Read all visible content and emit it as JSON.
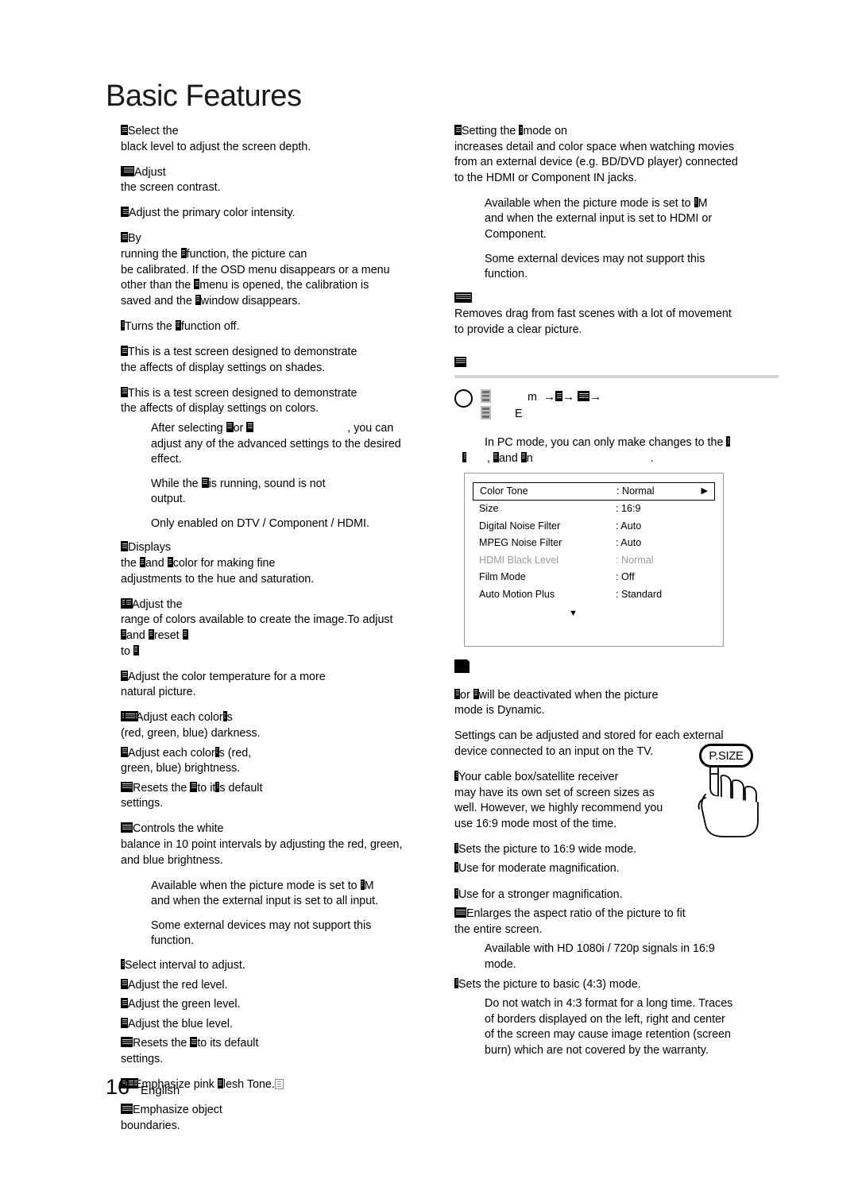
{
  "page": {
    "title": "Basic Features",
    "footer_number": "16",
    "footer_language": "English"
  },
  "left_column": {
    "blocks": [
      {
        "id": "black-tone",
        "lines": [
          "Select the",
          "black level to adjust the screen depth."
        ]
      },
      {
        "id": "contrast",
        "lines": [
          "Adjust",
          "the screen contrast."
        ]
      },
      {
        "id": "color",
        "lines": [
          "Adjust the primary color intensity."
        ]
      },
      {
        "id": "calibration",
        "lines": [
          "By",
          "running the function, the picture can",
          "be calibrated. If the OSD menu disappears or a menu",
          "other than the menu is opened, the calibration is",
          "saved and the window disappears."
        ]
      },
      {
        "id": "off",
        "lines": [
          "Turns the function off."
        ]
      },
      {
        "id": "test-shades",
        "lines": [
          "This is a test screen designed to demonstrate",
          "the affects of display settings on shades."
        ]
      },
      {
        "id": "test-colors",
        "lines": [
          "This is a test screen designed to demonstrate",
          "the affects of display settings on colors."
        ]
      },
      {
        "id": "note-after-selecting",
        "indent": true,
        "lines": [
          "After selecting or , you can",
          "adjust any of the advanced settings to the desired",
          "effect."
        ]
      },
      {
        "id": "note-sound",
        "indent": true,
        "lines": [
          "While the is running, sound is not",
          "output."
        ]
      },
      {
        "id": "note-dtv",
        "indent": true,
        "lines": [
          "Only enabled on DTV / Component / HDMI."
        ]
      },
      {
        "id": "displays-color",
        "lines": [
          "Displays",
          "the and color for making fine",
          "adjustments to the hue and saturation."
        ]
      },
      {
        "id": "color-space",
        "lines": [
          "Adjust the",
          "range of colors available to create the image.To adjust",
          "and reset",
          "to"
        ]
      },
      {
        "id": "white-balance",
        "lines": [
          "Adjust the color temperature for a more",
          "natural picture."
        ]
      },
      {
        "id": "rgb-offset",
        "lines": [
          "Adjust each color's",
          "(red, green, blue) darkness."
        ]
      },
      {
        "id": "rgb-gain",
        "lines": [
          "Adjust each color's (red,",
          "green, blue) brightness."
        ]
      },
      {
        "id": "reset-default-1",
        "lines": [
          "Resets the to its default",
          "settings."
        ]
      },
      {
        "id": "ten-point-white-balance",
        "lines": [
          "Controls the white",
          "balance in 10 point intervals by adjusting the red, green,",
          "and blue brightness."
        ]
      },
      {
        "id": "note-picture-mode",
        "indent": true,
        "lines": [
          "Available when the picture mode is set to",
          "and when the external input is set to all input."
        ]
      },
      {
        "id": "note-external-devices-1",
        "indent": true,
        "lines": [
          "Some external devices may not support this",
          "function."
        ]
      },
      {
        "id": "interval",
        "lines": [
          "Select interval to adjust."
        ]
      },
      {
        "id": "red-level",
        "lines": [
          "Adjust the red level."
        ]
      },
      {
        "id": "green-level",
        "lines": [
          "Adjust the green level."
        ]
      },
      {
        "id": "blue-level",
        "lines": [
          "Adjust the blue level."
        ]
      },
      {
        "id": "reset-default-2",
        "lines": [
          "Resets the to its default",
          "settings."
        ]
      },
      {
        "id": "flesh-tone",
        "lines": [
          "Emphasize pink Flesh Tone."
        ]
      },
      {
        "id": "edge-enhancement",
        "lines": [
          "Emphasize object",
          "boundaries."
        ]
      }
    ]
  },
  "right_column": {
    "blocks": [
      {
        "id": "cinema-mode",
        "lines": [
          "Setting the mode on",
          "increases detail and color space when watching movies",
          "from an external device (e.g. BD/DVD player) connected",
          "to the HDMI or Component IN jacks."
        ]
      },
      {
        "id": "note-cinema-available",
        "indent": true,
        "lines": [
          "Available when the picture mode is set to",
          "and when the external input is set to HDMI or",
          "Component."
        ]
      },
      {
        "id": "note-external-devices-2",
        "indent": true,
        "lines": [
          "Some external devices may not support this",
          "function."
        ]
      },
      {
        "id": "motion-judder",
        "lines": [
          "Removes drag from fast scenes with a lot of movement",
          "to provide a clear picture."
        ]
      }
    ],
    "section_header": {
      "id": "screen-adjustment",
      "label": ""
    },
    "nav_path": {
      "line1_prefix": "m",
      "line2_prefix": "E",
      "arrow": "→"
    },
    "pc_mode_note": [
      "In PC mode, you can only make changes to the",
      ", and"
    ],
    "note_section": {
      "blocks": [
        {
          "id": "deactivated-dynamic",
          "lines": [
            "or will be deactivated when the picture",
            "mode is Dynamic."
          ]
        },
        {
          "id": "stored-per-device",
          "lines": [
            "Settings can be adjusted and stored for each external",
            "device connected to an input on the TV."
          ]
        },
        {
          "id": "cable-box",
          "lines": [
            "Your cable box/satellite receiver",
            "may have its own set of screen sizes as",
            "well. However, we highly recommend you",
            "use 16:9 mode most of the time."
          ]
        },
        {
          "id": "wide-16-9",
          "lines": [
            "Sets the picture to 16:9 wide mode."
          ]
        },
        {
          "id": "zoom-1",
          "lines": [
            "Use for moderate magnification."
          ]
        },
        {
          "id": "zoom-2",
          "lines": [
            "Use for a stronger magnification."
          ]
        },
        {
          "id": "screen-fit",
          "lines": [
            "Enlarges the aspect ratio of the picture to fit",
            "the entire screen."
          ]
        },
        {
          "id": "note-hd-signals",
          "indent": true,
          "lines": [
            "Available with HD 1080i / 720p signals in 16:9",
            "mode."
          ]
        },
        {
          "id": "basic-4-3",
          "lines": [
            "Sets the picture to basic (4:3) mode."
          ]
        },
        {
          "id": "note-4-3-warning",
          "indent": true,
          "lines": [
            "Do not watch in 4:3 format for a long time. Traces",
            "of borders displayed on the left, right and center",
            "of the screen may cause image retention (screen",
            "burn) which are not covered by the warranty."
          ]
        }
      ]
    },
    "osd_menu": {
      "rows": [
        {
          "label": "Color Tone",
          "value": ": Normal",
          "selected": true,
          "dim": false,
          "arrow": "▶"
        },
        {
          "label": "Size",
          "value": ": 16:9",
          "selected": false,
          "dim": false,
          "arrow": ""
        },
        {
          "label": "Digital Noise Filter",
          "value": ": Auto",
          "selected": false,
          "dim": false,
          "arrow": ""
        },
        {
          "label": "MPEG Noise Filter",
          "value": ": Auto",
          "selected": false,
          "dim": false,
          "arrow": ""
        },
        {
          "label": "HDMI Black Level",
          "value": ": Normal",
          "selected": false,
          "dim": true,
          "arrow": ""
        },
        {
          "label": "Film Mode",
          "value": ": Off",
          "selected": false,
          "dim": false,
          "arrow": ""
        },
        {
          "label": "Auto Motion Plus",
          "value": ": Standard",
          "selected": false,
          "dim": false,
          "arrow": ""
        }
      ],
      "scroll_down_glyph": "▼"
    },
    "psize_button": {
      "label": "P.SIZE"
    }
  },
  "colors": {
    "rule": "#d3d3d3",
    "osd_border": "#9a9a9a",
    "dim_text": "#9b9b9b"
  }
}
